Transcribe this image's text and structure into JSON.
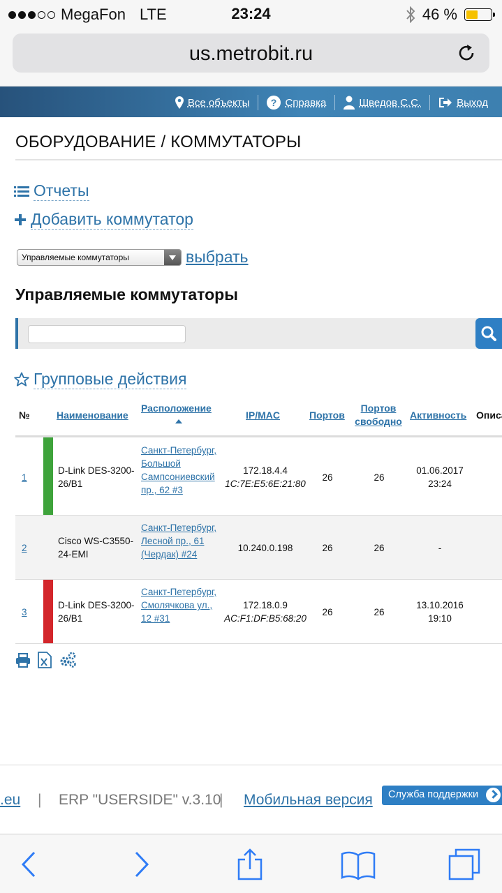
{
  "status_bar": {
    "carrier": "MegaFon",
    "network": "LTE",
    "time": "23:24",
    "battery_percent": "46 %",
    "battery_level": 0.46,
    "signal_bars_filled": 3,
    "signal_bars_total": 5
  },
  "browser": {
    "url": "us.metrobit.ru"
  },
  "topnav": {
    "all_objects": "Все объекты",
    "help": "Справка",
    "user": "Шведов С.С.",
    "logout": "Выход"
  },
  "page": {
    "title": "ОБОРУДОВАНИЕ / КОММУТАТОРЫ",
    "reports_label": "Отчеты",
    "add_switch_label": "Добавить коммутатор",
    "filter_selected": "Управляемые коммутаторы",
    "filter_apply": "выбрать",
    "section_title": "Управляемые коммутаторы",
    "search_placeholder": "",
    "group_actions_label": "Групповые действия"
  },
  "table": {
    "columns": {
      "num": "№",
      "name": "Наименование",
      "location": "Расположение",
      "ipmac": "IP/MAC",
      "ports": "Портов",
      "ports_free_1": "Портов",
      "ports_free_2": "свободно",
      "activity": "Активность",
      "description": "Описа"
    },
    "rows": [
      {
        "num": "1",
        "name": "D-Link DES-3200-26/B1",
        "location": "Санкт-Петербург, Большой Сампсониевский пр., 62 #3",
        "ip": "172.18.4.4",
        "mac": "1C:7E:E5:6E:21:80",
        "ports": "26",
        "ports_free": "26",
        "activity_date": "01.06.2017",
        "activity_time": "23:24",
        "status_color": "#3ea33b"
      },
      {
        "num": "2",
        "name": "Cisco WS-C3550-24-EMI",
        "location": "Санкт-Петербург, Лесной пр., 61 (Чердак) #24",
        "ip": "10.240.0.198",
        "mac": "",
        "ports": "26",
        "ports_free": "26",
        "activity_date": "-",
        "activity_time": "",
        "status_color": ""
      },
      {
        "num": "3",
        "name": "D-Link DES-3200-26/B1",
        "location": "Санкт-Петербург, Смолячкова ул., 12 #31",
        "ip": "172.18.0.9",
        "mac": "AC:F1:DF:B5:68:20",
        "ports": "26",
        "ports_free": "26",
        "activity_date": "13.10.2016",
        "activity_time": "19:10",
        "status_color": "#d3262b"
      }
    ]
  },
  "footer": {
    "eu_link": ".eu",
    "erp_version": "ERP \"USERSIDE\" v.3.10",
    "mobile_version": "Мобильная версия",
    "support": "Служба поддержки"
  },
  "colors": {
    "accent": "#2e73a8",
    "search_button": "#2e7fc4",
    "nav_band": "#3d80b0"
  }
}
